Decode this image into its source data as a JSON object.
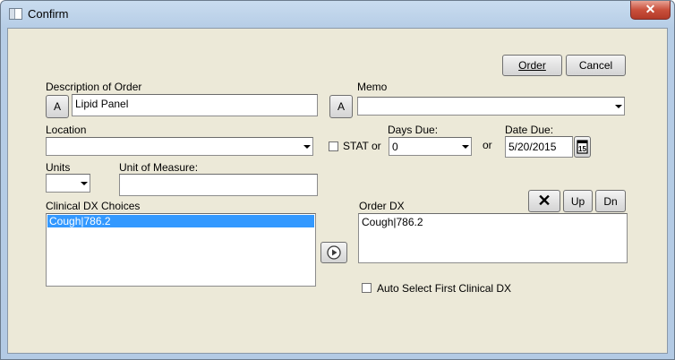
{
  "window": {
    "title": "Confirm",
    "close_label": "✕"
  },
  "buttons": {
    "order": "Order",
    "cancel": "Cancel",
    "desc_a": "A",
    "memo_a": "A",
    "up": "Up",
    "dn": "Dn",
    "remove": "✕"
  },
  "labels": {
    "description": "Description of Order",
    "memo": "Memo",
    "location": "Location",
    "stat": "STAT or",
    "days_due": "Days Due:",
    "or": "or",
    "date_due": "Date Due:",
    "units": "Units",
    "unit_of_measure": "Unit of Measure:",
    "clinical_dx": "Clinical DX Choices",
    "order_dx": "Order DX",
    "auto_select": "Auto Select First Clinical DX"
  },
  "fields": {
    "description": "Lipid Panel",
    "memo": "",
    "location": "",
    "days_due": "0",
    "date_due": "5/20/2015",
    "units": "",
    "unit_of_measure": ""
  },
  "clinical_dx_choices": [
    "Cough|786.2"
  ],
  "order_dx": [
    "Cough|786.2"
  ],
  "checkboxes": {
    "stat": false,
    "auto_select": false
  }
}
